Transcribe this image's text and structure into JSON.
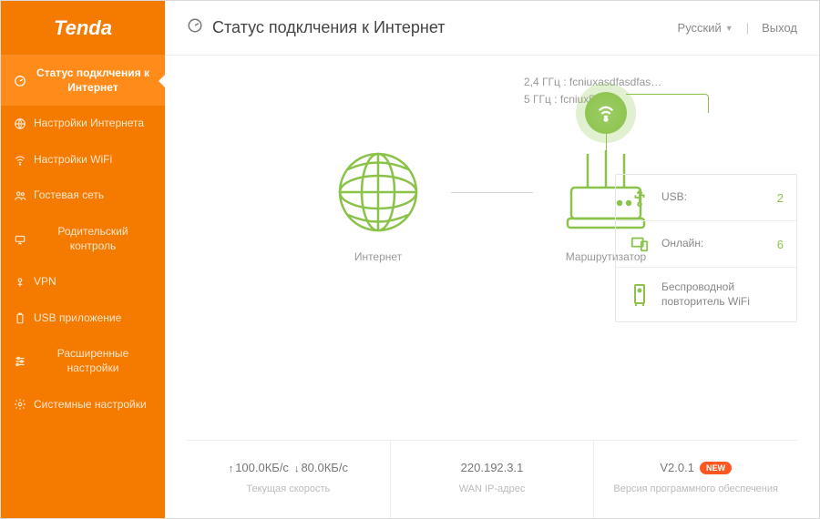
{
  "logo": "Tenda",
  "sidebar": {
    "items": [
      {
        "label": "Статус подклчения к Интернет"
      },
      {
        "label": "Настройки Интернета"
      },
      {
        "label": "Настройки WiFi"
      },
      {
        "label": "Гостевая сеть"
      },
      {
        "label": "Родительский контроль"
      },
      {
        "label": "VPN"
      },
      {
        "label": "USB приложение"
      },
      {
        "label": "Расширенные настройки"
      },
      {
        "label": "Системные настройки"
      }
    ]
  },
  "header": {
    "title": "Статус подклчения к Интернет",
    "language": "Русский",
    "logout": "Выход"
  },
  "ssid": {
    "line24": "2,4 ГГц : fcniuxasdfasdfas…",
    "line5": "5 ГГц : fcniux5G"
  },
  "diagram": {
    "internet_label": "Интернет",
    "router_label": "Маршрутизатор"
  },
  "sidepanel": {
    "usb_label": "USB:",
    "usb_value": "2",
    "online_label": "Онлайн:",
    "online_value": "6",
    "repeater_label": "Беспроводной повторитель WiFi"
  },
  "footer": {
    "speed_up": "100.0КБ/с",
    "speed_down": "80.0КБ/с",
    "speed_label": "Текущая скорость",
    "wan_ip": "220.192.3.1",
    "wan_label": "WAN IP-адрес",
    "version": "V2.0.1",
    "version_badge": "NEW",
    "version_label": "Версия программного обеспечения"
  }
}
